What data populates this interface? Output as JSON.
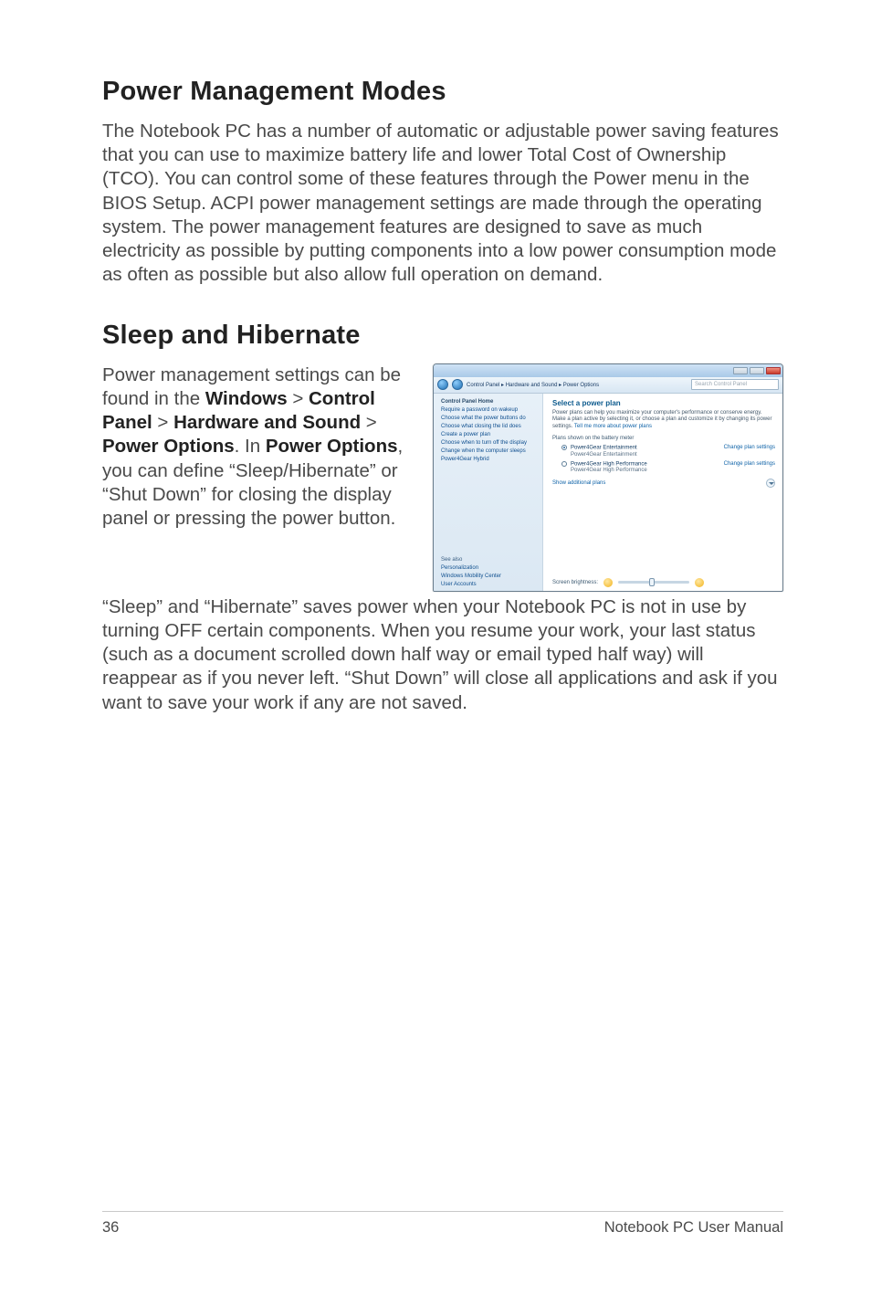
{
  "headings": {
    "h1": "Power Management Modes",
    "h2": "Sleep and Hibernate"
  },
  "paragraphs": {
    "p1": "The Notebook PC has a number of automatic or adjustable power saving features that you can use to maximize battery life and lower Total Cost of Ownership (TCO). You can control some of these features through the Power menu in the BIOS Setup. ACPI power management settings are made through the operating system. The power management features are designed to save as much electricity as possible by putting components into a low power consumption mode as often as possible but also allow full operation on demand.",
    "p2_pre": "Power management settings can be found in the ",
    "p2_b1": "Windows",
    "p2_gt1": " > ",
    "p2_b2": "Control Panel",
    "p2_gt2": " > ",
    "p2_b3": "Hardware and Sound",
    "p2_gt3": " > ",
    "p2_b4": "Power Options",
    "p2_mid": ". In ",
    "p2_b5": "Power Options",
    "p2_post": ", you can define “Sleep/Hibernate” or “Shut Down” for closing the display panel or pressing the power button.",
    "p3": "“Sleep” and “Hibernate” saves power when your Notebook PC is not in use by turning OFF certain components. When you resume your work, your last status (such as a document scrolled down half way or email typed half way) will reappear as if you never left. “Shut Down” will close all applications and ask if you want to save your work if any are not saved."
  },
  "footer": {
    "page": "36",
    "title": "Notebook PC User Manual"
  },
  "po": {
    "breadcrumb": "Control Panel  ▸  Hardware and Sound  ▸  Power Options",
    "search_placeholder": "Search Control Panel",
    "side": {
      "home": "Control Panel Home",
      "l1": "Require a password on wakeup",
      "l2": "Choose what the power buttons do",
      "l3": "Choose what closing the lid does",
      "l4": "Create a power plan",
      "l5": "Choose when to turn off the display",
      "l6": "Change when the computer sleeps",
      "l7": "Power4Gear Hybrid",
      "see_also": "See also",
      "sa1": "Personalization",
      "sa2": "Windows Mobility Center",
      "sa3": "User Accounts"
    },
    "main": {
      "heading": "Select a power plan",
      "desc": "Power plans can help you maximize your computer's performance or conserve energy. Make a plan active by selecting it, or choose a plan and customize it by changing its power settings. ",
      "tell": "Tell me more about power plans",
      "meter_label": "Plans shown on the battery meter",
      "plan1": "Power4Gear Entertainment",
      "plan1_sub": "Power4Gear Entertainment",
      "plan2": "Power4Gear High Performance",
      "plan2_sub": "Power4Gear High Performance",
      "change": "Change plan settings",
      "show_more": "Show additional plans",
      "brightness": "Screen brightness:"
    }
  }
}
